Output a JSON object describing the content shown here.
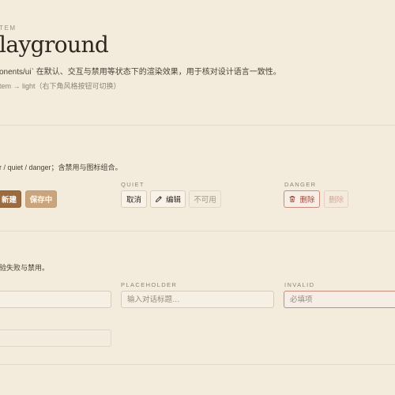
{
  "header": {
    "eyebrow": "TEM",
    "title": "layground",
    "description": "onents/ui` 在默认、交互与禁用等状态下的渲染效果，用于核对设计语言一致性。",
    "meta": "tem → light（右下角风格按钮可切换）"
  },
  "buttons_section": {
    "description": "r / quiet / danger；含禁用与图标组合。",
    "primary": {
      "new_label": "新建",
      "loading_label": "保存中"
    },
    "quiet": {
      "column_label": "QUIET",
      "cancel_label": "取消",
      "edit_label": "编辑",
      "disabled_label": "不可用"
    },
    "danger": {
      "column_label": "DANGER",
      "delete_label": "删除",
      "delete_disabled_label": "删除"
    }
  },
  "inputs_section": {
    "description": "验失败与禁用。",
    "placeholder_column": {
      "column_label": "PLACEHOLDER",
      "placeholder": "输入对话标题…"
    },
    "invalid_column": {
      "column_label": "INVALID",
      "placeholder": "必填项"
    }
  },
  "icons": {
    "edit": "pencil-icon",
    "delete": "trash-icon"
  },
  "colors": {
    "background": "#F3EBDC",
    "primary": "#9C6B3F",
    "primary_loading": "#C9A57D",
    "danger": "#A24A3A"
  }
}
